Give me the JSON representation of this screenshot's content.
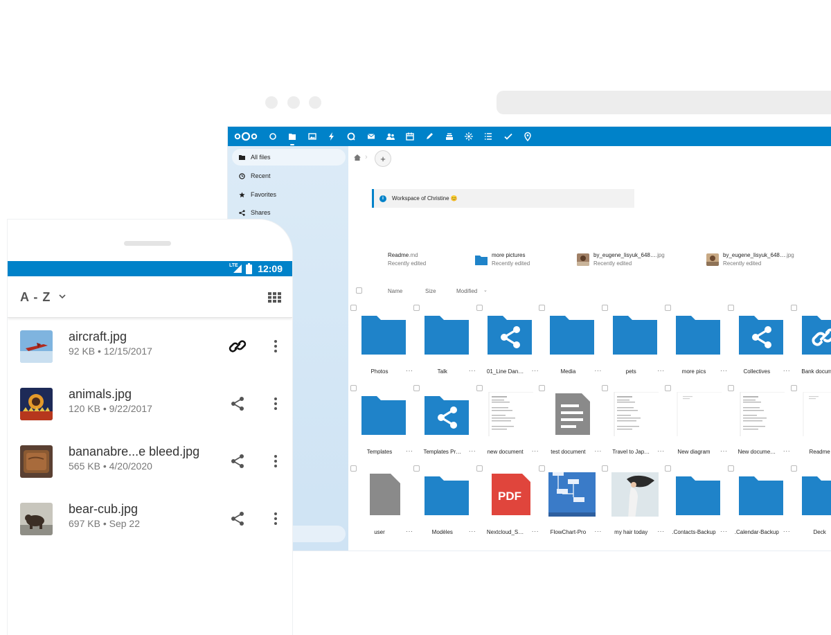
{
  "browser": {
    "window_dots": [
      "dot",
      "dot",
      "dot"
    ]
  },
  "desktop": {
    "app_icons": [
      "dashboard-icon",
      "files-icon",
      "photos-icon",
      "activity-icon",
      "talk-icon",
      "mail-icon",
      "contacts-icon",
      "calendar-icon",
      "notes-icon",
      "deck-icon",
      "bookmarks-icon",
      "tasks-icon",
      "check-icon",
      "maps-icon"
    ],
    "sidebar": {
      "items": [
        {
          "label": "All files",
          "icon": "folder-icon",
          "active": true
        },
        {
          "label": "Recent",
          "icon": "clock-icon"
        },
        {
          "label": "Favorites",
          "icon": "star-icon"
        },
        {
          "label": "Shares",
          "icon": "share-icon"
        }
      ],
      "partial_char": "e"
    },
    "breadcrumb": {
      "add_label": "+"
    },
    "workspace": {
      "text": "Workspace of Christine 😊"
    },
    "recent": [
      {
        "name": "Readme",
        "ext": ".md",
        "status": "Recently edited"
      },
      {
        "name": "more pictures",
        "ext": "",
        "status": "Recently edited"
      },
      {
        "name": "by_eugene_lisyuk_648…",
        "ext": ".jpg",
        "status": "Recently edited"
      },
      {
        "name": "by_eugene_lisyuk_648…",
        "ext": ".jpg",
        "status": "Recently edited"
      }
    ],
    "columns": {
      "name": "Name",
      "size": "Size",
      "modified": "Modified"
    },
    "files": [
      {
        "name": "Photos",
        "type": "folder"
      },
      {
        "name": "Talk",
        "type": "folder"
      },
      {
        "name": "01_Line Dan…",
        "type": "shared-folder"
      },
      {
        "name": "Media",
        "type": "folder"
      },
      {
        "name": "pets",
        "type": "folder"
      },
      {
        "name": "more pics",
        "type": "folder"
      },
      {
        "name": "Collectives",
        "type": "shared-folder"
      },
      {
        "name": "Bank docum…",
        "type": "link-folder"
      },
      {
        "name": "Templates",
        "type": "folder"
      },
      {
        "name": "Templates Pr…",
        "type": "shared-folder"
      },
      {
        "name": "new document",
        "type": "doc"
      },
      {
        "name": "test document",
        "type": "text"
      },
      {
        "name": "Travel to Jap…",
        "type": "doc"
      },
      {
        "name": "New diagram",
        "type": "blank"
      },
      {
        "name": "New docume…",
        "type": "doc"
      },
      {
        "name": "Readme",
        "type": "blank"
      },
      {
        "name": "user",
        "type": "file"
      },
      {
        "name": "Modèles",
        "type": "folder"
      },
      {
        "name": "Nextcloud_S…",
        "type": "pdf"
      },
      {
        "name": "FlowChart-Pro",
        "type": "chart"
      },
      {
        "name": "my hair today",
        "type": "photo"
      },
      {
        "name": ".Contacts-Backup",
        "type": "folder"
      },
      {
        "name": ".Calendar-Backup",
        "type": "folder"
      },
      {
        "name": "Deck",
        "type": "folder"
      }
    ],
    "pdf_label": "PDF",
    "more_label": "···"
  },
  "phone": {
    "status": {
      "network": "LTE",
      "time": "12:09"
    },
    "sort": {
      "label": "A - Z"
    },
    "files": [
      {
        "name": "aircraft.jpg",
        "meta": "92 KB • 12/15/2017",
        "action": "link-icon",
        "thumb": "aircraft"
      },
      {
        "name": "animals.jpg",
        "meta": "120 KB • 9/22/2017",
        "action": "share-icon",
        "thumb": "animals"
      },
      {
        "name": "bananabre...e bleed.jpg",
        "meta": "565 KB • 4/20/2020",
        "action": "share-icon",
        "thumb": "bread"
      },
      {
        "name": "bear-cub.jpg",
        "meta": "697 KB • Sep 22",
        "action": "share-icon",
        "thumb": "bear"
      }
    ]
  },
  "colors": {
    "brand": "#0082c9",
    "folder": "#1f83c9",
    "sidebar": "#d6e8f6",
    "pdf": "#e0453c"
  }
}
